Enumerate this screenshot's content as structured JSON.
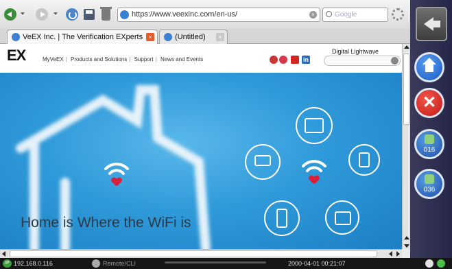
{
  "browser": {
    "url": "https://www.veexinc.com/en-us/",
    "search_placeholder": "Google",
    "tabs": [
      {
        "label": "VeEX Inc. | The Verification EXperts",
        "active": true
      },
      {
        "label": "(Untitled)",
        "active": false
      }
    ],
    "icons": [
      "back-icon",
      "forward-icon",
      "reload-icon",
      "save-icon",
      "trash-icon",
      "gear-icon"
    ]
  },
  "site": {
    "logo": "EX",
    "nav": [
      "MyVeEX",
      "Products and Solutions",
      "Support",
      "News and Events"
    ],
    "partner_logo": "Digital Lightwave",
    "social_icons": [
      "flag-icon",
      "pinterest-icon",
      "youtube-icon",
      "linkedin-icon"
    ],
    "social_in": "in"
  },
  "hero": {
    "title": "Home is Where the WiFi is",
    "accent": "#d91f3c"
  },
  "panel": {
    "app1_label": "016",
    "app2_label": "036",
    "close_glyph": "✕"
  },
  "status": {
    "ip": "192.168.0.116",
    "ip_badge": "IP",
    "remote": "Remote/CLI",
    "datetime": "2000-04-01 00:21:07"
  }
}
